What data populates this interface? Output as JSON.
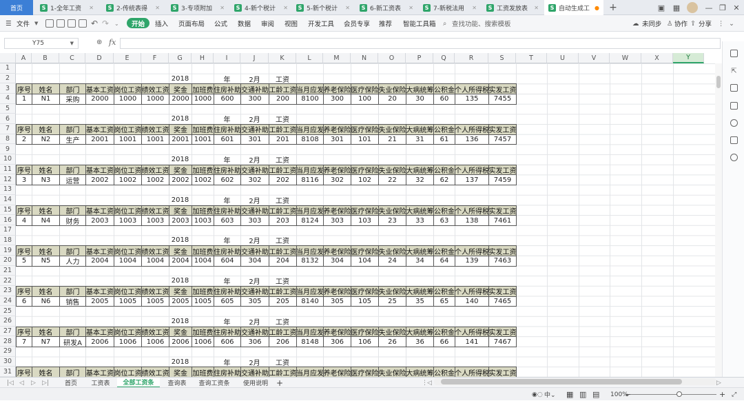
{
  "tabs": [
    {
      "label": "首页"
    },
    {
      "label": "1-全年工资"
    },
    {
      "label": "2-传统表得"
    },
    {
      "label": "3-专项附加"
    },
    {
      "label": "4-新个税计"
    },
    {
      "label": "5-新个税计"
    },
    {
      "label": "6-新工资表"
    },
    {
      "label": "7-新税法用"
    },
    {
      "label": "工资发放表"
    },
    {
      "label": "自动生成工"
    }
  ],
  "window_controls": {
    "add": "+",
    "min": "—",
    "restore": "❐",
    "close": "✕"
  },
  "menu": {
    "file": "文件",
    "start": "开始",
    "insert": "插入",
    "page_layout": "页面布局",
    "formula": "公式",
    "data": "数据",
    "review": "审阅",
    "view": "视图",
    "dev_tools": "开发工具",
    "member": "会员专享",
    "recommend": "推荐",
    "smart_toolbox": "智能工具箱",
    "search": "查找功能、搜索模板",
    "sync": "未同步",
    "collab": "协作",
    "share": "分享"
  },
  "formula_bar": {
    "cell_ref": "Y75",
    "fx": "fx",
    "value": ""
  },
  "columns": [
    "A",
    "B",
    "C",
    "D",
    "E",
    "F",
    "G",
    "H",
    "I",
    "J",
    "K",
    "L",
    "M",
    "N",
    "O",
    "P",
    "Q",
    "R",
    "S",
    "T",
    "U",
    "V",
    "W",
    "X",
    "Y"
  ],
  "selected_column": "Y",
  "rows": [
    "1",
    "2",
    "3",
    "4",
    "5",
    "6",
    "7",
    "8",
    "9",
    "10",
    "11",
    "12",
    "13",
    "14",
    "15",
    "16",
    "17",
    "18",
    "19",
    "20",
    "21",
    "22",
    "23",
    "24",
    "25",
    "26",
    "27",
    "28",
    "29",
    "30",
    "31"
  ],
  "block_title": {
    "year": "2018",
    "year_unit": "年",
    "month": "2月",
    "wage": "工资"
  },
  "headers": [
    "序号",
    "姓名",
    "部门",
    "基本工资",
    "岗位工资",
    "绩效工资",
    "奖金",
    "加班费",
    "住房补助",
    "交通补助",
    "工龄工资",
    "当月应发",
    "养老保险",
    "医疗保险",
    "失业保险",
    "大病统筹",
    "公积金",
    "个人所得税",
    "实发工资"
  ],
  "records": [
    [
      "1",
      "N1",
      "采购",
      "2000",
      "1000",
      "1000",
      "2000",
      "1000",
      "600",
      "300",
      "200",
      "8100",
      "300",
      "100",
      "20",
      "30",
      "60",
      "135",
      "7455"
    ],
    [
      "2",
      "N2",
      "生产",
      "2001",
      "1001",
      "1001",
      "2001",
      "1001",
      "601",
      "301",
      "201",
      "8108",
      "301",
      "101",
      "21",
      "31",
      "61",
      "136",
      "7457"
    ],
    [
      "3",
      "N3",
      "运营",
      "2002",
      "1002",
      "1002",
      "2002",
      "1002",
      "602",
      "302",
      "202",
      "8116",
      "302",
      "102",
      "22",
      "32",
      "62",
      "137",
      "7459"
    ],
    [
      "4",
      "N4",
      "财务",
      "2003",
      "1003",
      "1003",
      "2003",
      "1003",
      "603",
      "303",
      "203",
      "8124",
      "303",
      "103",
      "23",
      "33",
      "63",
      "138",
      "7461"
    ],
    [
      "5",
      "N5",
      "人力",
      "2004",
      "1004",
      "1004",
      "2004",
      "1004",
      "604",
      "304",
      "204",
      "8132",
      "304",
      "104",
      "24",
      "34",
      "64",
      "139",
      "7463"
    ],
    [
      "6",
      "N6",
      "销售",
      "2005",
      "1005",
      "1005",
      "2005",
      "1005",
      "605",
      "305",
      "205",
      "8140",
      "305",
      "105",
      "25",
      "35",
      "65",
      "140",
      "7465"
    ],
    [
      "7",
      "N7",
      "研发A",
      "2006",
      "1006",
      "1006",
      "2006",
      "1006",
      "606",
      "306",
      "206",
      "8148",
      "306",
      "106",
      "26",
      "36",
      "66",
      "141",
      "7467"
    ]
  ],
  "sheets": [
    "首页",
    "工资表",
    "全部工资条",
    "查询表",
    "查询工资条",
    "使用说明"
  ],
  "active_sheet": "全部工资条",
  "status": {
    "zoom": "100%",
    "minus": "−",
    "plus": "+"
  },
  "colors": {
    "accent": "#2fa56a",
    "header_fill": "#d9d9c2",
    "home_tab": "#3c7fd6"
  }
}
